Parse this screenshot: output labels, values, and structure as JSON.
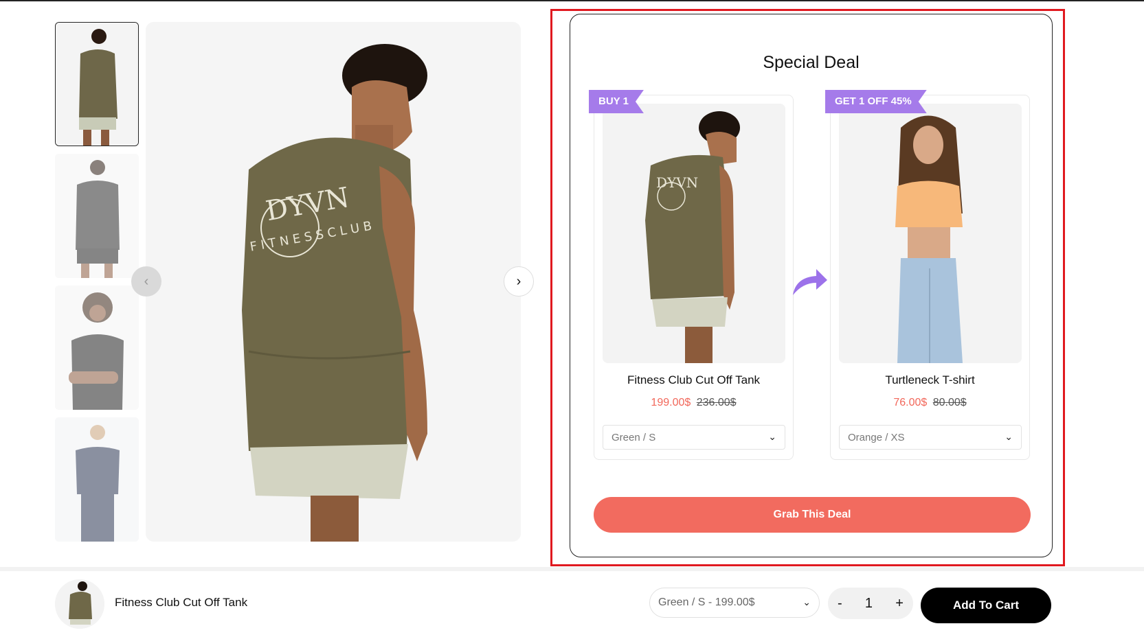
{
  "deal": {
    "title": "Special Deal",
    "products": [
      {
        "ribbon": "BUY 1",
        "name": "Fitness Club Cut Off Tank",
        "price_now": "199.00$",
        "price_old": "236.00$",
        "variant": "Green / S"
      },
      {
        "ribbon": "GET 1 OFF 45%",
        "name": "Turtleneck T-shirt",
        "price_now": "76.00$",
        "price_old": "80.00$",
        "variant": "Orange / XS"
      }
    ],
    "cta": "Grab This Deal"
  },
  "sticky_bar": {
    "product_name": "Fitness Club Cut Off Tank",
    "variant": "Green / S - 199.00$",
    "qty_minus": "-",
    "qty_value": "1",
    "qty_plus": "+",
    "add_to_cart": "Add To Cart"
  },
  "colors": {
    "accent_ribbon": "#a57bea",
    "price": "#f2675a",
    "cta": "#f26b5f",
    "highlight_border": "#e0191f"
  },
  "icons": {
    "prev": "chevron-left-icon",
    "next": "chevron-right-icon",
    "dropdown": "chevron-down-icon",
    "deal_arrow": "curved-arrow-icon"
  }
}
